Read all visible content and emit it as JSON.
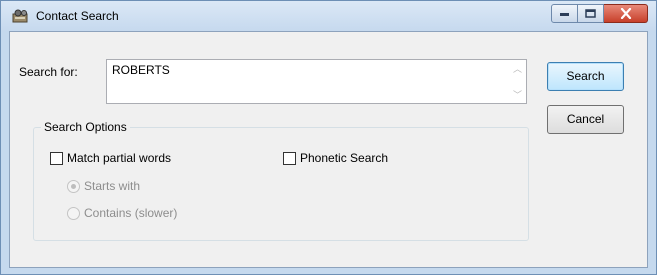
{
  "window": {
    "title": "Contact Search",
    "icon": "contact-book-icon"
  },
  "controls": {
    "minimize_glyph": "▬",
    "maximize_glyph": "▫",
    "close_glyph": "✕"
  },
  "search": {
    "label": "Search for:",
    "value": "ROBERTS",
    "scroll_up": "︿",
    "scroll_down": "﹀"
  },
  "buttons": {
    "search": "Search",
    "cancel": "Cancel"
  },
  "options": {
    "group_title": "Search Options",
    "match_partial": {
      "label": "Match partial words",
      "checked": false
    },
    "phonetic": {
      "label": "Phonetic Search",
      "checked": false
    },
    "starts_with": {
      "label": "Starts with",
      "selected": true,
      "enabled": false
    },
    "contains": {
      "label": "Contains (slower)",
      "selected": false,
      "enabled": false
    }
  },
  "colors": {
    "frame": "#c5d9ee",
    "client": "#f0f0f0",
    "close_button": "#c7402b",
    "default_button": "#bee6fd"
  }
}
